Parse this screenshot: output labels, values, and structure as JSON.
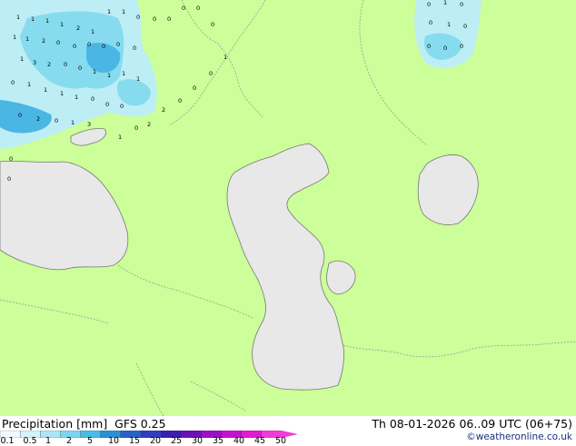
{
  "map": {
    "product_title": "Precipitation [mm]",
    "model": "GFS 0.25",
    "valid_time": "Th 08-01-2026 06..09 UTC (06+75)",
    "credit": "©weatheronline.co.uk",
    "colors": {
      "land": "#ccff99",
      "water": "#e8e8e8",
      "border": "#9a9a9a",
      "precip_light": "#bdeef5",
      "precip_medium": "#86dcee",
      "precip_heavy": "#4ab6e3"
    }
  },
  "legend": {
    "ticks": [
      "0.1",
      "0.5",
      "1",
      "2",
      "5",
      "10",
      "15",
      "20",
      "25",
      "30",
      "35",
      "40",
      "45",
      "50"
    ],
    "colors": [
      "#f0fbff",
      "#d4f3fb",
      "#a9e6f6",
      "#7dd5f0",
      "#48bde6",
      "#2e8fd8",
      "#2a62c8",
      "#2f3fbd",
      "#3a1fae",
      "#6a12b6",
      "#9a10c4",
      "#c412cc",
      "#e41ad0",
      "#f23cd8"
    ]
  },
  "precip_labels": {
    "values": [
      "1",
      "1",
      "1",
      "1",
      "2",
      "1",
      "1",
      "1",
      "0",
      "0",
      "0",
      "0",
      "0",
      "0",
      "1",
      "1",
      "2",
      "0",
      "0",
      "0",
      "0",
      "0",
      "0",
      "1",
      "3",
      "2",
      "0",
      "0",
      "1",
      "1",
      "1",
      "1",
      "0",
      "1",
      "1",
      "1",
      "1",
      "0",
      "0",
      "0",
      "0",
      "2",
      "0",
      "1",
      "3",
      "0",
      "1",
      "0",
      "0",
      "1",
      "0",
      "0",
      "0",
      "0",
      "0",
      "0",
      "1",
      "0",
      "2",
      "2",
      "0",
      "0",
      "0",
      "1"
    ]
  }
}
